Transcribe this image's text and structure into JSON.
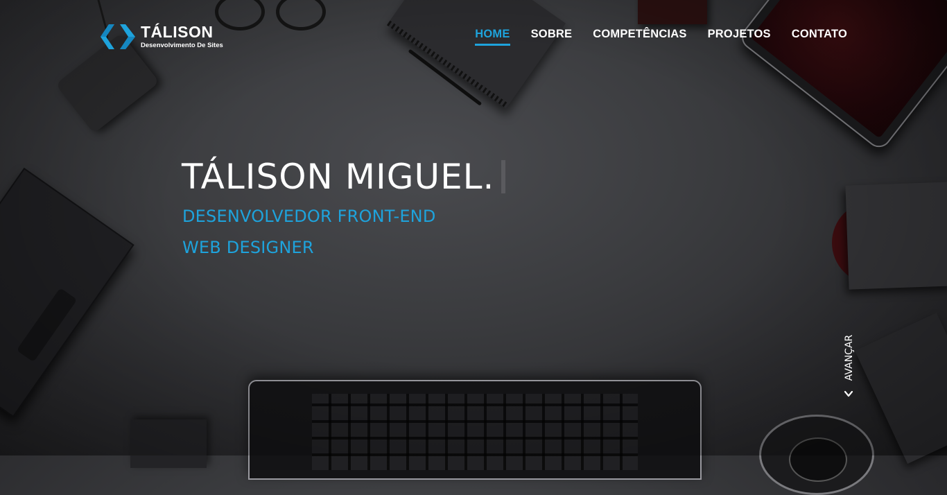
{
  "brand": {
    "title": "TÁLISON",
    "subtitle": "Desenvolvimento De Sites",
    "logo_icon": "code-brackets-icon",
    "colors": {
      "accent": "#1ea3dc",
      "accent_dark": "#1587c0"
    }
  },
  "nav": {
    "items": [
      {
        "label": "HOME",
        "active": true
      },
      {
        "label": "SOBRE",
        "active": false
      },
      {
        "label": "COMPETÊNCIAS",
        "active": false
      },
      {
        "label": "PROJETOS",
        "active": false
      },
      {
        "label": "CONTATO",
        "active": false
      }
    ]
  },
  "hero": {
    "name": "TÁLISON MIGUEL.",
    "roles": [
      "DESENVOLVEDOR FRONT-END",
      "WEB DESIGNER"
    ]
  },
  "advance": {
    "label": "AVANÇAR",
    "icon": "chevron-down-icon"
  }
}
